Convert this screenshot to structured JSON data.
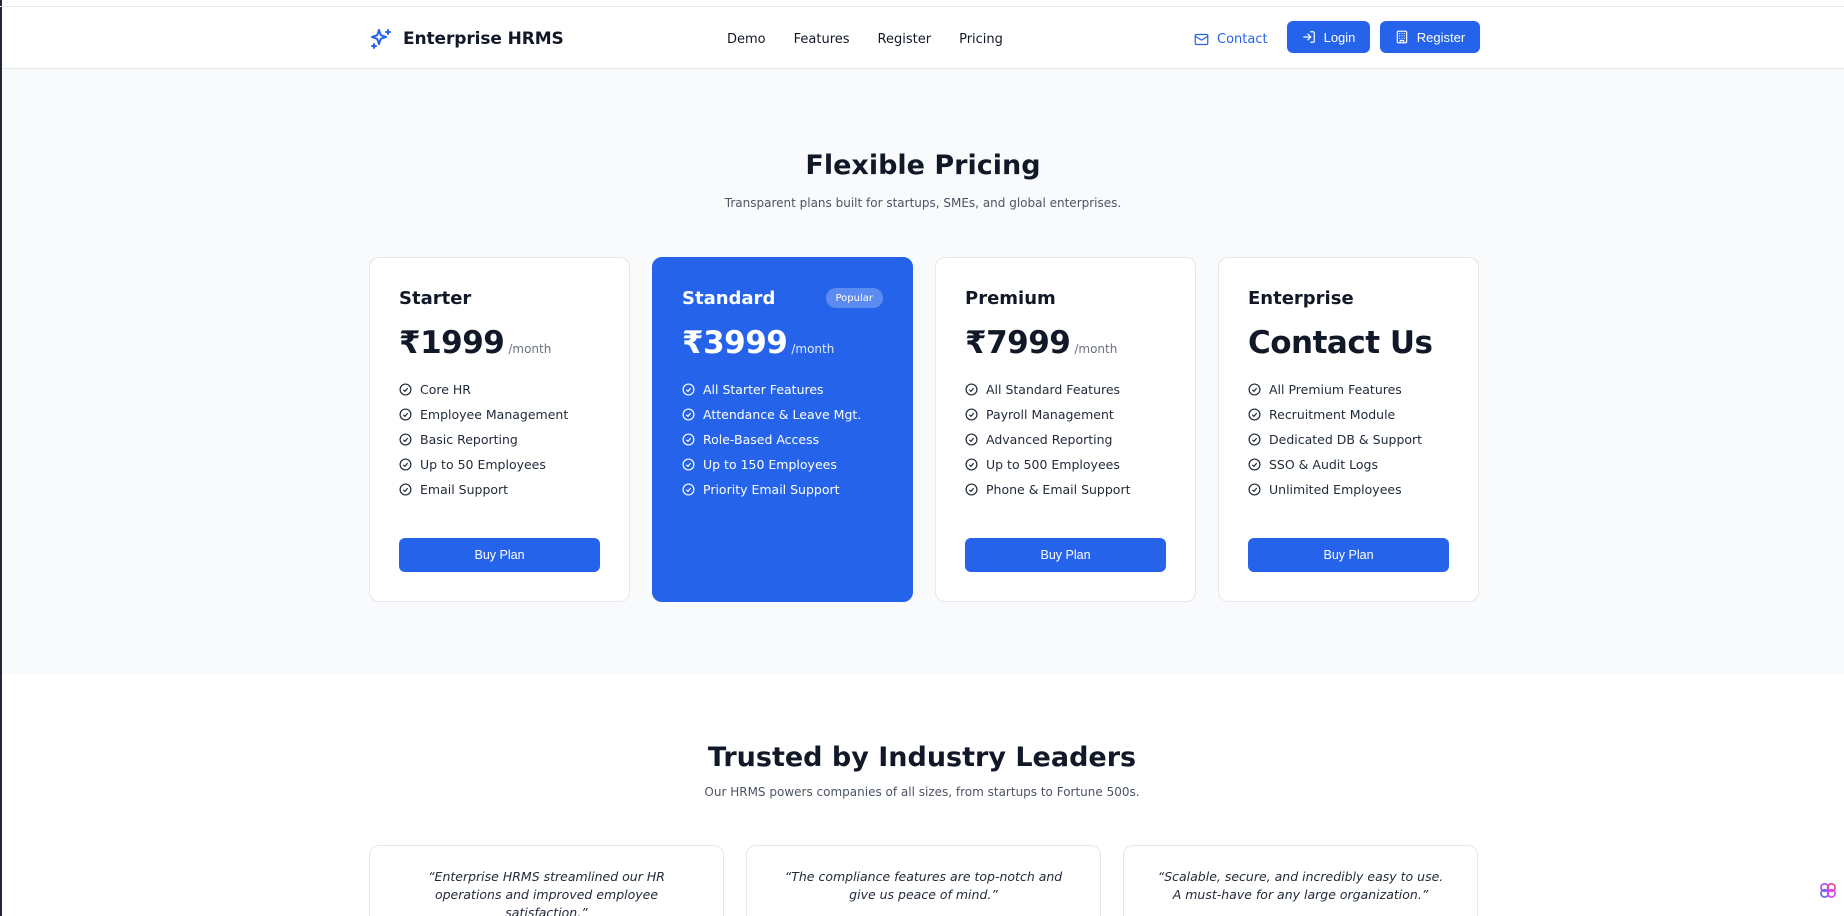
{
  "header": {
    "brand": "Enterprise HRMS",
    "nav": [
      "Demo",
      "Features",
      "Register",
      "Pricing"
    ],
    "contact_label": "Contact",
    "login_label": "Login",
    "register_label": "Register"
  },
  "pricing": {
    "title": "Flexible Pricing",
    "subtitle": "Transparent plans built for startups, SMEs, and global enterprises.",
    "plans": [
      {
        "name": "Starter",
        "price": "₹1999",
        "period": "/month",
        "features": [
          "Core HR",
          "Employee Management",
          "Basic Reporting",
          "Up to 50 Employees",
          "Email Support"
        ],
        "button": "Buy Plan"
      },
      {
        "name": "Standard",
        "badge": "Popular",
        "price": "₹3999",
        "period": "/month",
        "features": [
          "All Starter Features",
          "Attendance & Leave Mgt.",
          "Role-Based Access",
          "Up to 150 Employees",
          "Priority Email Support"
        ]
      },
      {
        "name": "Premium",
        "price": "₹7999",
        "period": "/month",
        "features": [
          "All Standard Features",
          "Payroll Management",
          "Advanced Reporting",
          "Up to 500 Employees",
          "Phone & Email Support"
        ],
        "button": "Buy Plan"
      },
      {
        "name": "Enterprise",
        "price": "Contact Us",
        "features": [
          "All Premium Features",
          "Recruitment Module",
          "Dedicated DB & Support",
          "SSO & Audit Logs",
          "Unlimited Employees"
        ],
        "button": "Buy Plan"
      }
    ]
  },
  "testimonials": {
    "title": "Trusted by Industry Leaders",
    "subtitle": "Our HRMS powers companies of all sizes, from startups to Fortune 500s.",
    "quotes": [
      "“Enterprise HRMS streamlined our HR operations and improved employee satisfaction.”",
      "“The compliance features are top-notch and give us peace of mind.”",
      "“Scalable, secure, and incredibly easy to use. A must-have for any large organization.”"
    ]
  },
  "colors": {
    "accent": "#2563eb",
    "section_bg": "#f8fafc",
    "text": "#111827"
  }
}
